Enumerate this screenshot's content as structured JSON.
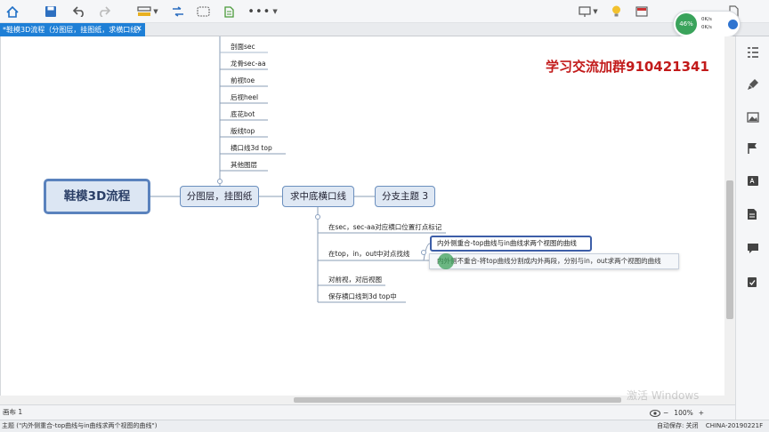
{
  "tab": {
    "title": "*鞋模3D流程（分图层，挂图纸，求横口线）",
    "close": "✕"
  },
  "speed": {
    "percent": "46%",
    "up": "0K/s",
    "down": "0K/s"
  },
  "watermark_text": "学习交流加群910421341",
  "central_topic": "鞋模3D流程",
  "main_topics": [
    "分图层，挂图纸",
    "求中底横口线",
    "分支主题 3"
  ],
  "layer_subtopics": [
    "剖面sec",
    "龙骨sec-aa",
    "前视toe",
    "后视heel",
    "底花bot",
    "版线top",
    "横口线3d top",
    "其他图层"
  ],
  "hengkou_subtopics": [
    "在sec，sec-aa对应横口位置打点标记",
    "在top，in，out中对点找线",
    "对前视，对后视图",
    "保存横口线到3d top中"
  ],
  "selected_topics": [
    "内外侧重合-top曲线与in曲线求两个视图的曲线",
    "内外侧不重合-将top曲线分割成内外两段，分别与in，out求两个视图的曲线"
  ],
  "sheetbar": {
    "sheet": "画布 1",
    "zoom": "100%",
    "minus": "−",
    "plus": "+"
  },
  "status": {
    "left": "主题 (\"内外侧重合-top曲线与in曲线求两个视图的曲线\")",
    "autosave": "自动保存: 关闭",
    "machine": "CHINA-20190221F"
  },
  "windows_watermark": "激活 Windows",
  "colors": {
    "accent": "#1e7fd6",
    "topic_border": "#6b8fbe",
    "central_border": "#5a82bd",
    "watermark": "#c21a1a"
  }
}
